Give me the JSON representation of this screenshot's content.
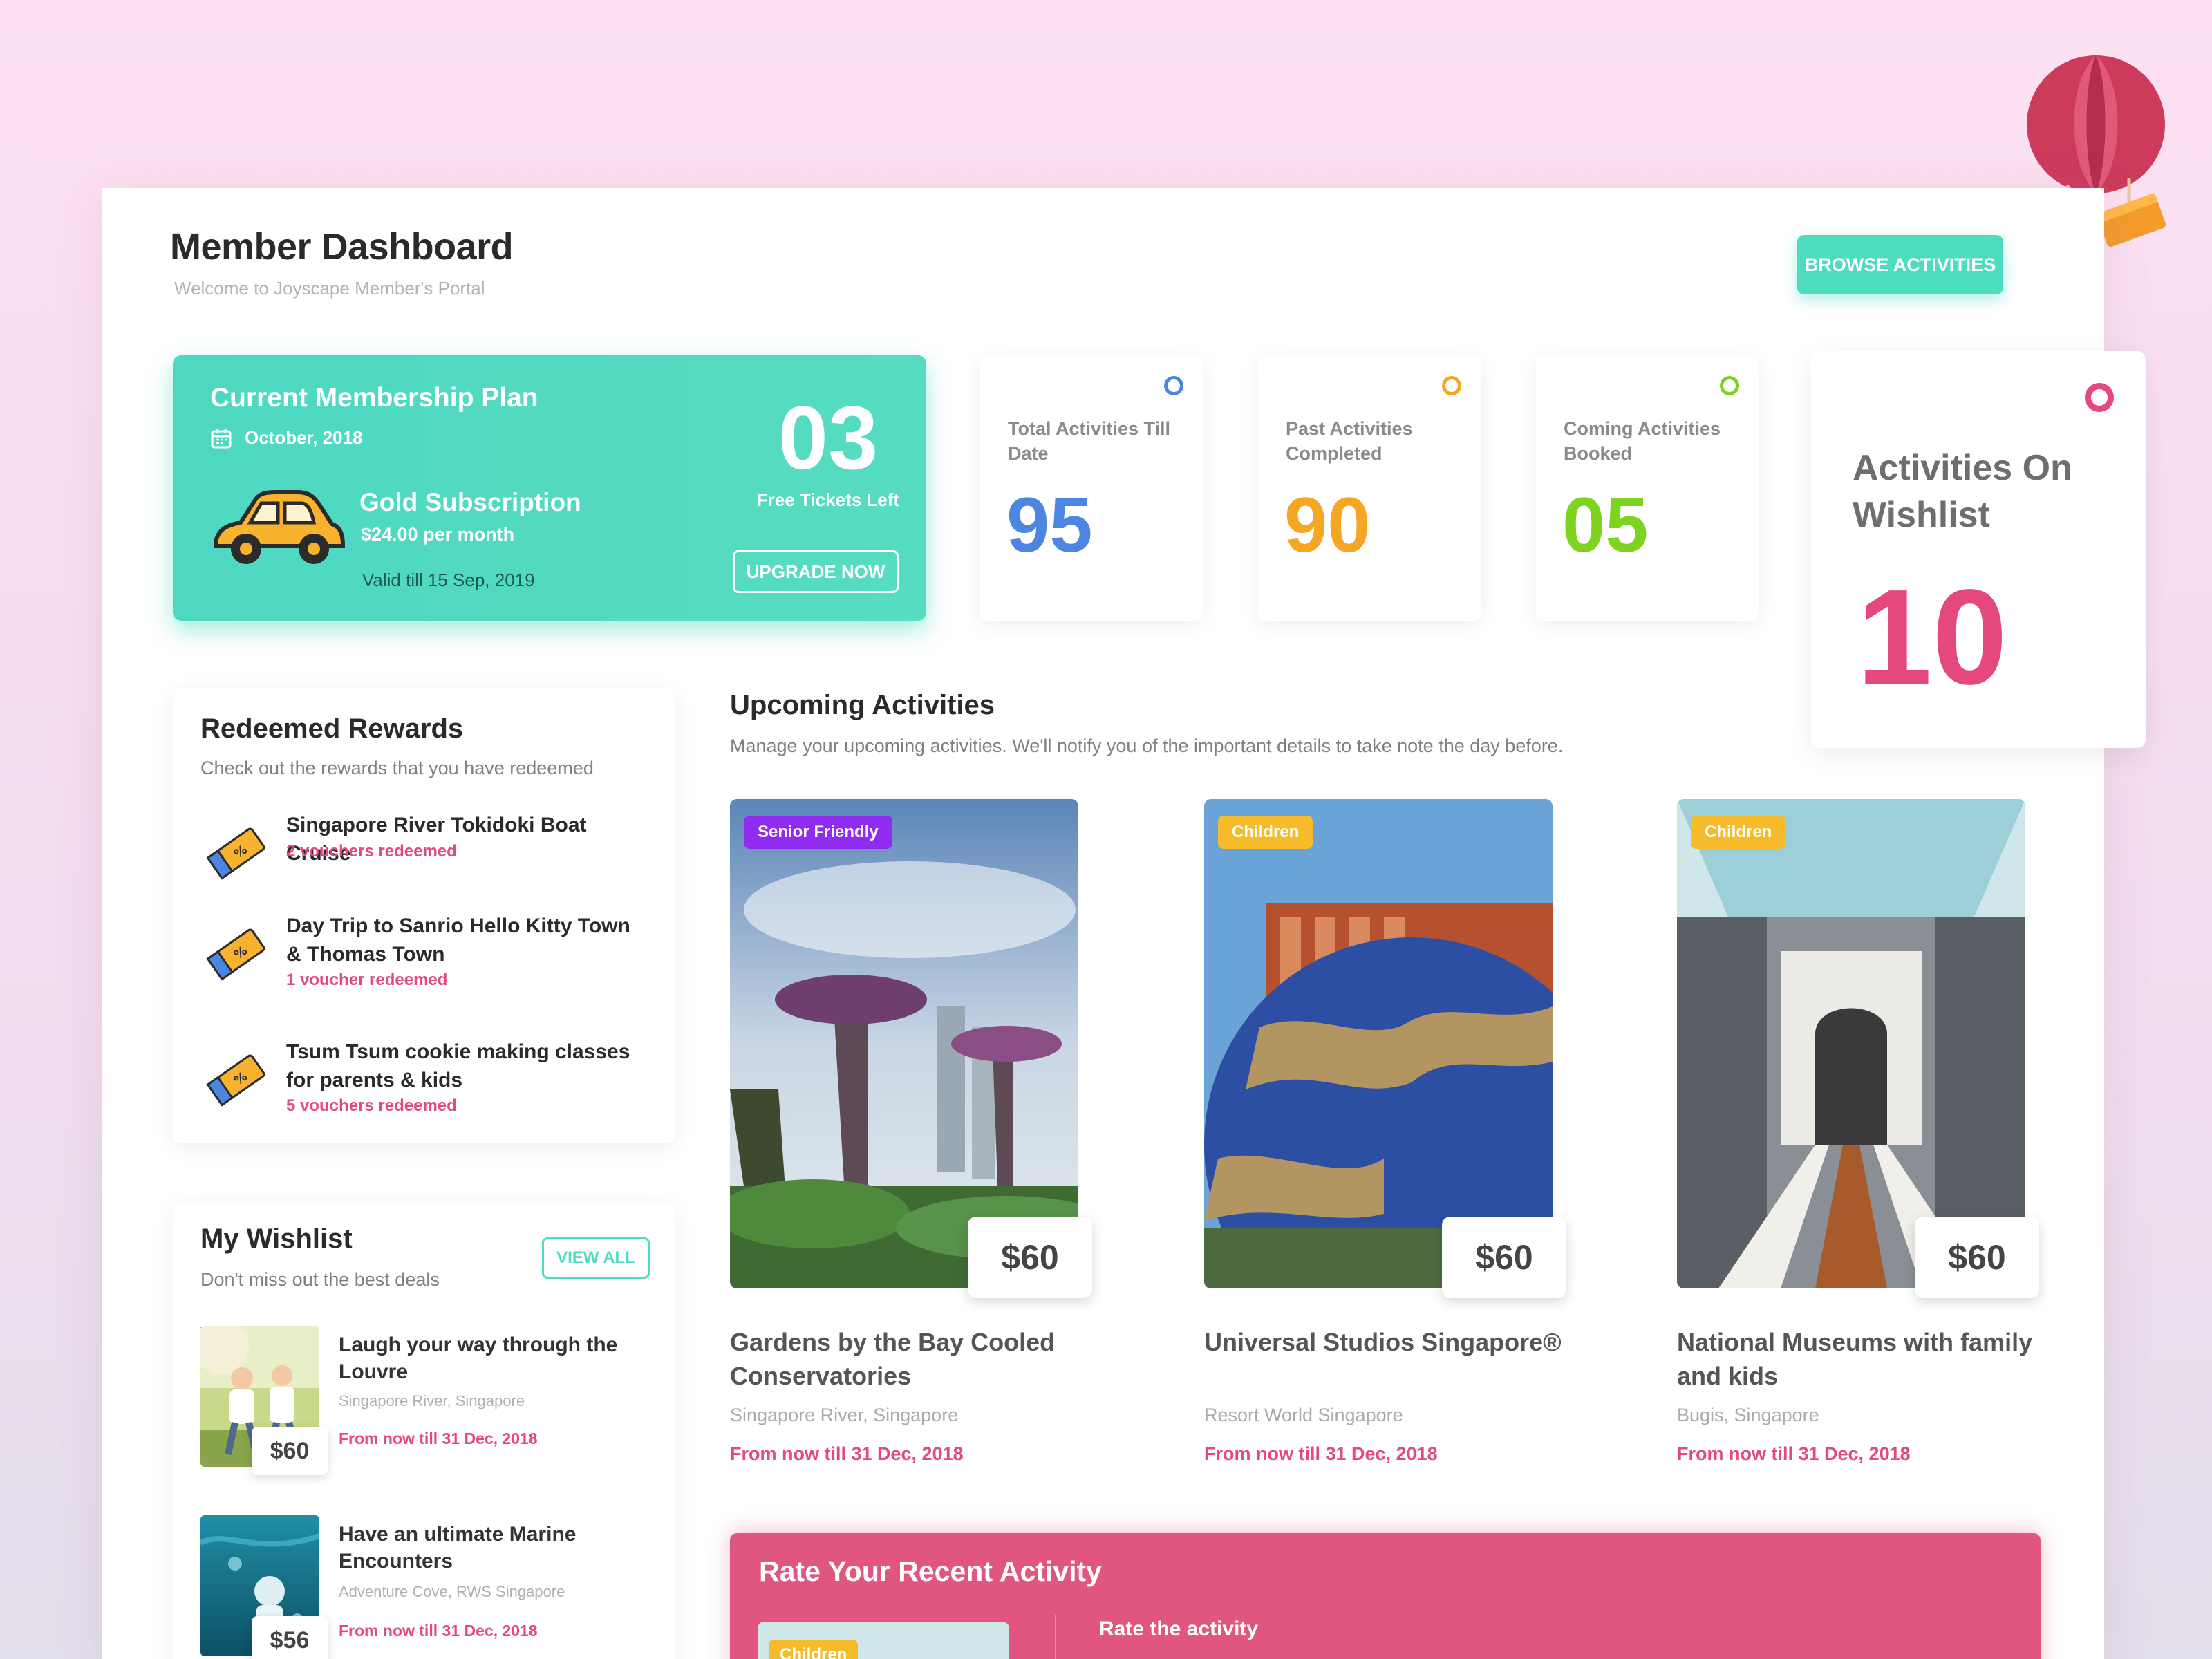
{
  "header": {
    "title": "Member Dashboard",
    "subtitle": "Welcome to Joyscape Member's Portal",
    "browse_button": "BROWSE ACTIVITIES"
  },
  "membership": {
    "title": "Current Membership Plan",
    "date": "October, 2018",
    "plan_name": "Gold Subscription",
    "price": "$24.00 per month",
    "valid": "Valid till 15 Sep, 2019",
    "tickets_count": "03",
    "tickets_label": "Free Tickets Left",
    "upgrade_button": "UPGRADE NOW"
  },
  "stats": [
    {
      "label": "Total Activities Till Date",
      "value": "95",
      "color": "#4c86e0"
    },
    {
      "label": "Past Activities Completed",
      "value": "90",
      "color": "#f5a623"
    },
    {
      "label": "Coming Activities Booked",
      "value": "05",
      "color": "#7ed321"
    }
  ],
  "wishlist_stat": {
    "label": "Activities On Wishlist",
    "value": "10",
    "color": "#e5497b"
  },
  "rewards": {
    "title": "Redeemed Rewards",
    "subtitle": "Check out the rewards that you have redeemed",
    "items": [
      {
        "name": "Singapore River Tokidoki Boat Cruise",
        "count": "2 vouchers redeemed"
      },
      {
        "name": "Day Trip to Sanrio Hello Kitty Town & Thomas Town",
        "count": "1 voucher redeemed"
      },
      {
        "name": "Tsum Tsum cookie making classes for parents & kids",
        "count": "5 vouchers redeemed"
      }
    ]
  },
  "wishlist": {
    "title": "My Wishlist",
    "subtitle": "Don't miss out the best deals",
    "view_all": "VIEW ALL",
    "items": [
      {
        "name": "Laugh your way through the Louvre",
        "location": "Singapore River, Singapore",
        "date": "From now till 31 Dec, 2018",
        "price": "$60"
      },
      {
        "name": "Have an ultimate Marine Encounters",
        "location": "Adventure Cove, RWS Singapore",
        "date": "From now till 31 Dec, 2018",
        "price": "$56"
      }
    ]
  },
  "upcoming": {
    "title": "Upcoming Activities",
    "subtitle": "Manage your upcoming activities. We'll notify you of the important details to take note the day before.",
    "items": [
      {
        "tag": "Senior Friendly",
        "tag_color": "#8f2cf0",
        "price": "$60",
        "name": "Gardens by the Bay Cooled Conservatories",
        "location": "Singapore River, Singapore",
        "date": "From now till 31 Dec, 2018"
      },
      {
        "tag": "Children",
        "tag_color": "#f6bb2a",
        "price": "$60",
        "name": "Universal Studios Singapore®",
        "location": "Resort World Singapore",
        "date": "From now till 31 Dec, 2018"
      },
      {
        "tag": "Children",
        "tag_color": "#f6bb2a",
        "price": "$60",
        "name": "National Museums with family and kids",
        "location": "Bugis, Singapore",
        "date": "From now till 31 Dec, 2018"
      }
    ]
  },
  "rate": {
    "title": "Rate Your Recent Activity",
    "tag": "Children",
    "label": "Rate the activity"
  },
  "icons": {
    "balloon": "hot-air-balloon-icon",
    "calendar": "calendar-icon",
    "car": "car-icon",
    "ticket": "discount-ticket-icon"
  }
}
